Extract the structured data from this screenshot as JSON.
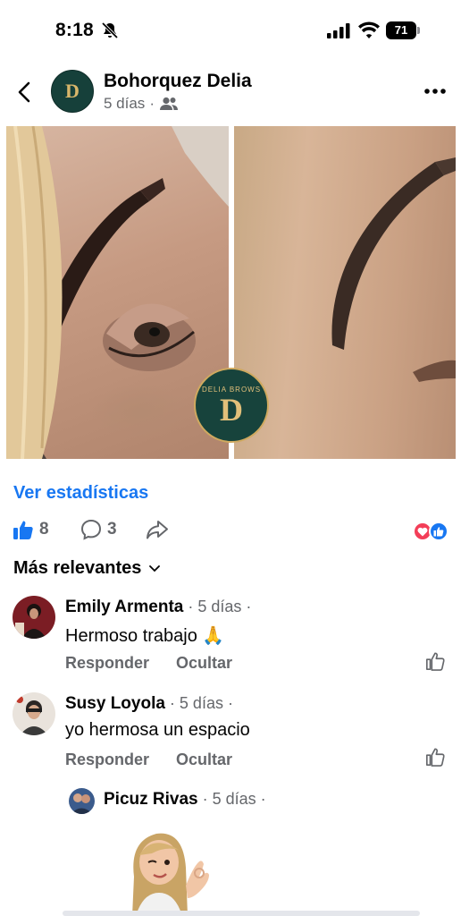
{
  "status_bar": {
    "time": "8:18",
    "battery": "71"
  },
  "post": {
    "author": "Bohorquez Delia",
    "time": "5 días",
    "separator": "·",
    "avatar_letter": "D",
    "photo_logo_letter": "D",
    "photo_logo_text": "DELIA BROWS"
  },
  "stats_link": "Ver estadísticas",
  "actions": {
    "like_count": "8",
    "comment_count": "3"
  },
  "sort_label": "Más relevantes",
  "comments": [
    {
      "name": "Emily Armenta",
      "time": " · 5 días ·",
      "text": "Hermoso trabajo 🙏",
      "reply": "Responder",
      "hide": "Ocultar"
    },
    {
      "name": "Susy Loyola",
      "time": " · 5 días ·",
      "text": "yo hermosa un espacio",
      "reply": "Responder",
      "hide": "Ocultar"
    }
  ],
  "reply": {
    "name": "Picuz Rivas",
    "time": " · 5 días ·"
  },
  "colors": {
    "accent": "#1877f2",
    "muted": "#65676b",
    "brand_green": "#16403a",
    "brand_gold": "#cfa95f"
  },
  "icons": [
    "back-icon",
    "more-icon",
    "friends-icon",
    "like-icon",
    "comment-icon",
    "share-icon",
    "chevron-down-icon",
    "bell-slash-icon",
    "signal-icon",
    "wifi-icon"
  ]
}
